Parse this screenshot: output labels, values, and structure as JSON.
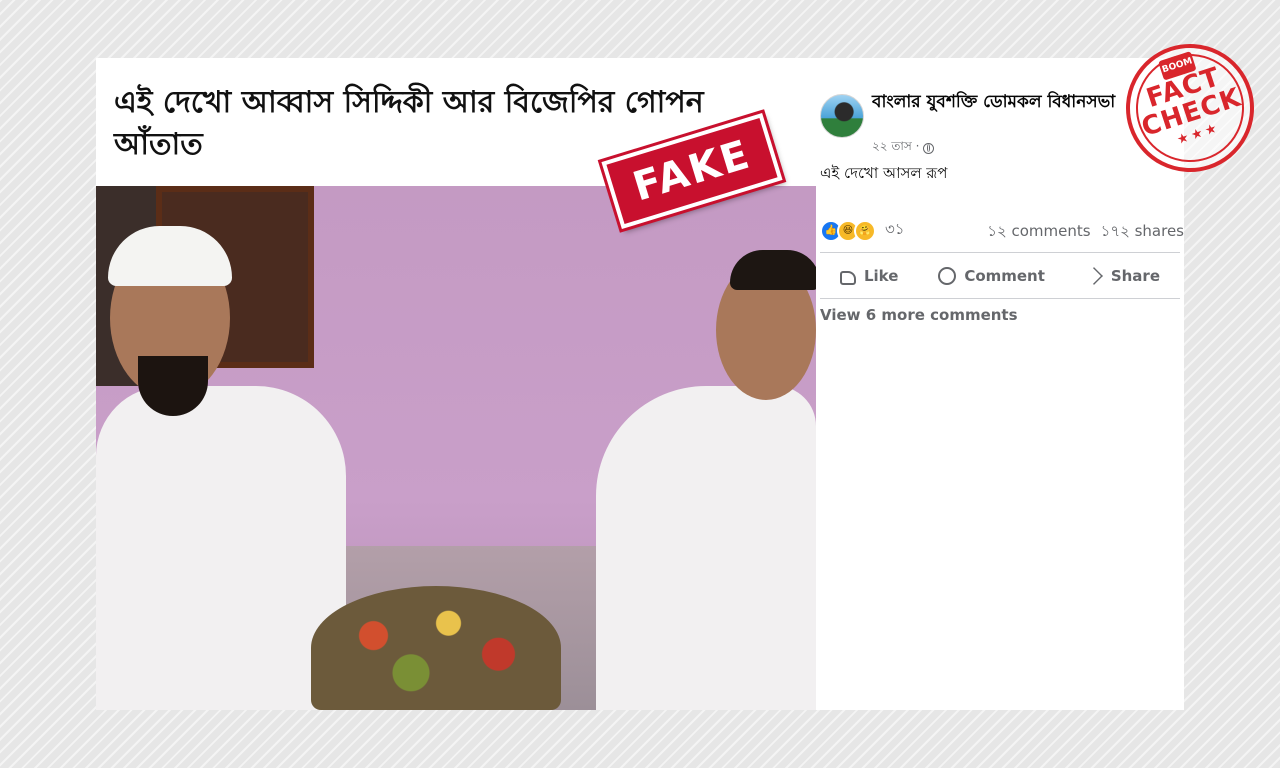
{
  "shared_image": {
    "headline": "এই দেখো আব্বাস সিদ্দিকী আর বিজেপির গোপন আঁতাত",
    "stamp": "FAKE"
  },
  "post": {
    "page_name": "বাংলার যুবশক্তি ডোমকল বিধানসভা",
    "time": "২২ তাস ·",
    "caption": "এই দেখো আসল রূপ",
    "reaction_count": "৩১",
    "comments": "১২ comments",
    "shares": "১৭২ shares",
    "actions": {
      "like": "Like",
      "comment": "Comment",
      "share": "Share"
    },
    "view_more": "View 6 more comments"
  },
  "fact_check": {
    "brand": "BOOM",
    "line1": "FACT",
    "line2": "CHECK",
    "stars": "★★★"
  },
  "icons": [
    "globe-icon",
    "like-reaction-icon",
    "haha-reaction-icon",
    "care-reaction-icon",
    "thumbs-up-icon",
    "comment-icon",
    "share-icon"
  ],
  "colors": {
    "fake_red": "#c8102e",
    "fact_check_red": "#d9262c",
    "facebook_gray": "#65676b",
    "facebook_blue": "#1877f2"
  }
}
